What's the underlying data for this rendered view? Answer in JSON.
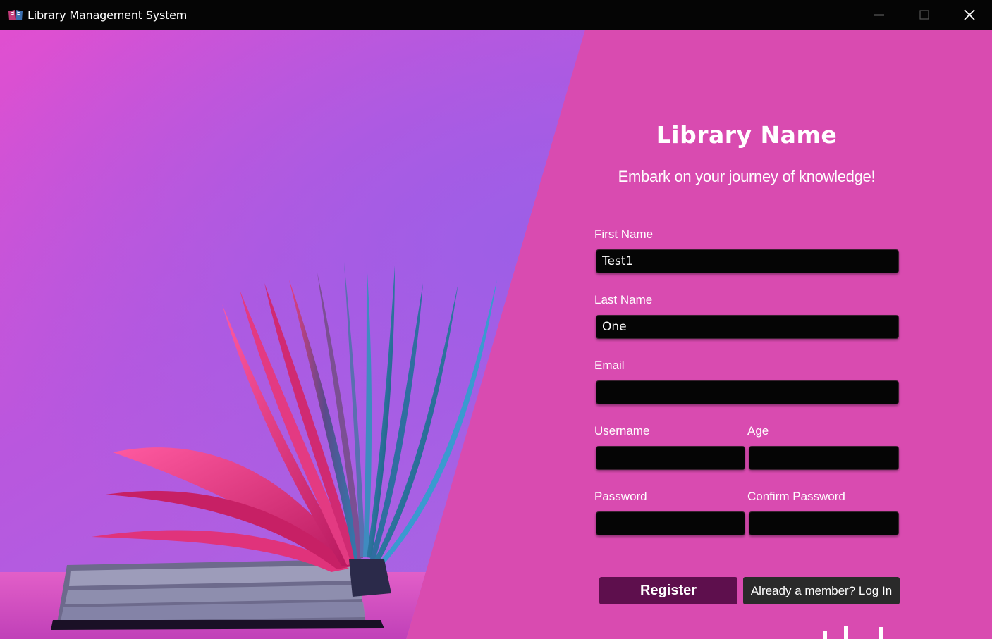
{
  "window": {
    "title": "Library Management System",
    "icon": "book-app-icon",
    "controls": [
      "minimize-icon",
      "maximize-icon",
      "close-icon"
    ]
  },
  "form": {
    "library_name": "Library Name",
    "tagline": "Embark on your journey of knowledge!",
    "first_name": {
      "label": "First Name",
      "value": "Test1"
    },
    "last_name": {
      "label": "Last Name",
      "value": "One"
    },
    "email": {
      "label": "Email",
      "value": ""
    },
    "username": {
      "label": "Username",
      "value": ""
    },
    "age": {
      "label": "Age",
      "value": ""
    },
    "password": {
      "label": "Password",
      "value": ""
    },
    "confirm_password": {
      "label": "Confirm Password",
      "value": ""
    },
    "register_label": "Register",
    "login_label": "Already a member? Log In"
  },
  "colors": {
    "panel": "#d94bb0",
    "field": "#050505",
    "register_button": "#5e0f4d",
    "login_button": "#2a2a2a",
    "titlebar": "#050505"
  }
}
